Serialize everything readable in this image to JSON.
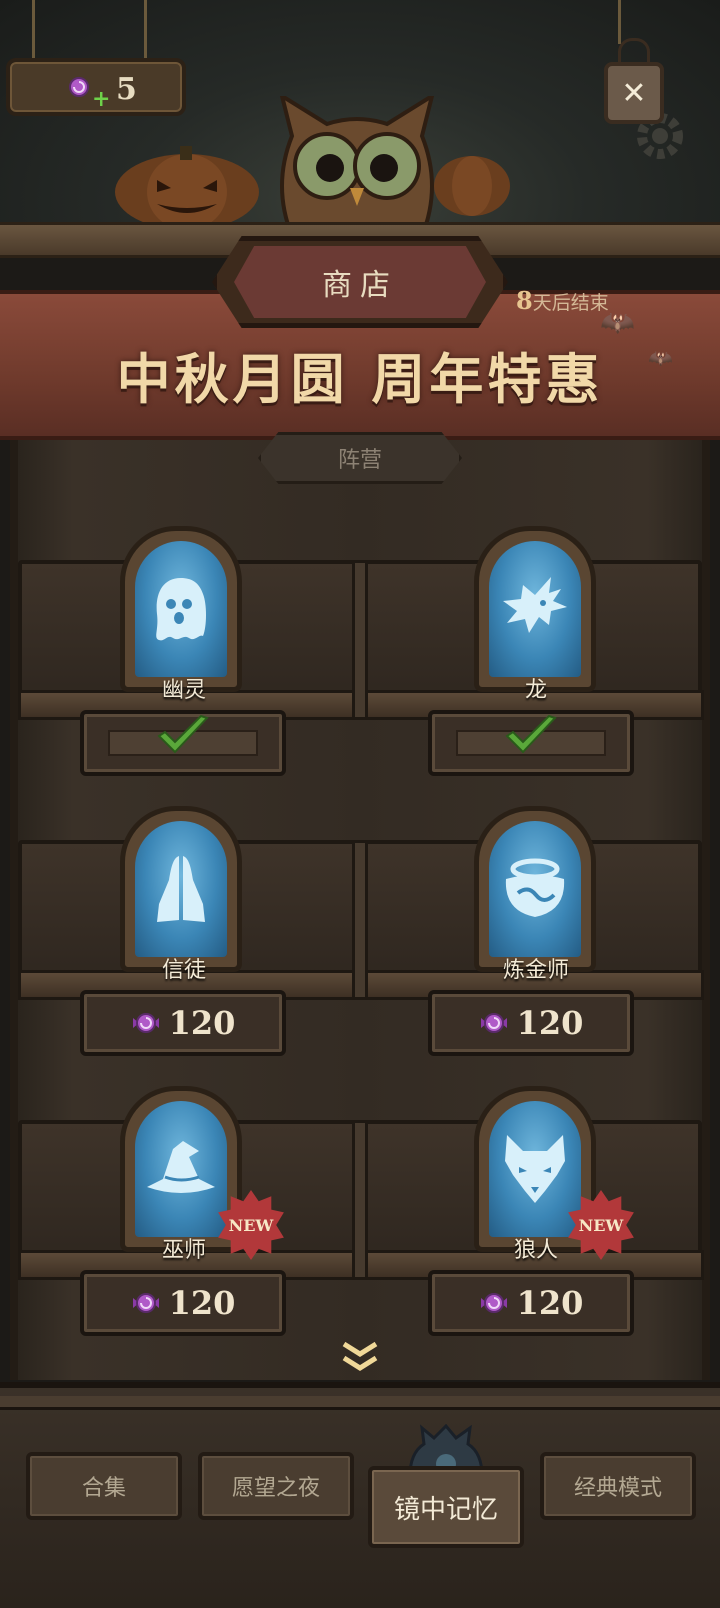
{
  "header": {
    "currency_amount": "5",
    "close_label": "✕"
  },
  "banner": {
    "shop_title": "商店",
    "event_title": "中秋月圆 周年特惠",
    "days_left": "8",
    "days_suffix": "天后结束"
  },
  "faction_tab": "阵营",
  "items": [
    {
      "label": "幽灵",
      "icon": "ghost-icon",
      "status": "owned"
    },
    {
      "label": "龙",
      "icon": "dragon-icon",
      "status": "owned"
    },
    {
      "label": "信徒",
      "icon": "praying-hands-icon",
      "price": "120"
    },
    {
      "label": "炼金师",
      "icon": "cauldron-icon",
      "price": "120"
    },
    {
      "label": "巫师",
      "icon": "wizard-hat-icon",
      "price": "120",
      "badge": "NEW"
    },
    {
      "label": "狼人",
      "icon": "wolf-icon",
      "price": "120",
      "badge": "NEW"
    }
  ],
  "nav": {
    "tabs": [
      "合集",
      "愿望之夜",
      "镜中记忆",
      "经典模式"
    ],
    "active_index": 2
  },
  "colors": {
    "banner_red": "#6f3a2c",
    "glass_blue": "#3b86b6",
    "check_green": "#5aa83a",
    "candy_purple": "#b05ac8",
    "new_red": "#b2383a"
  }
}
